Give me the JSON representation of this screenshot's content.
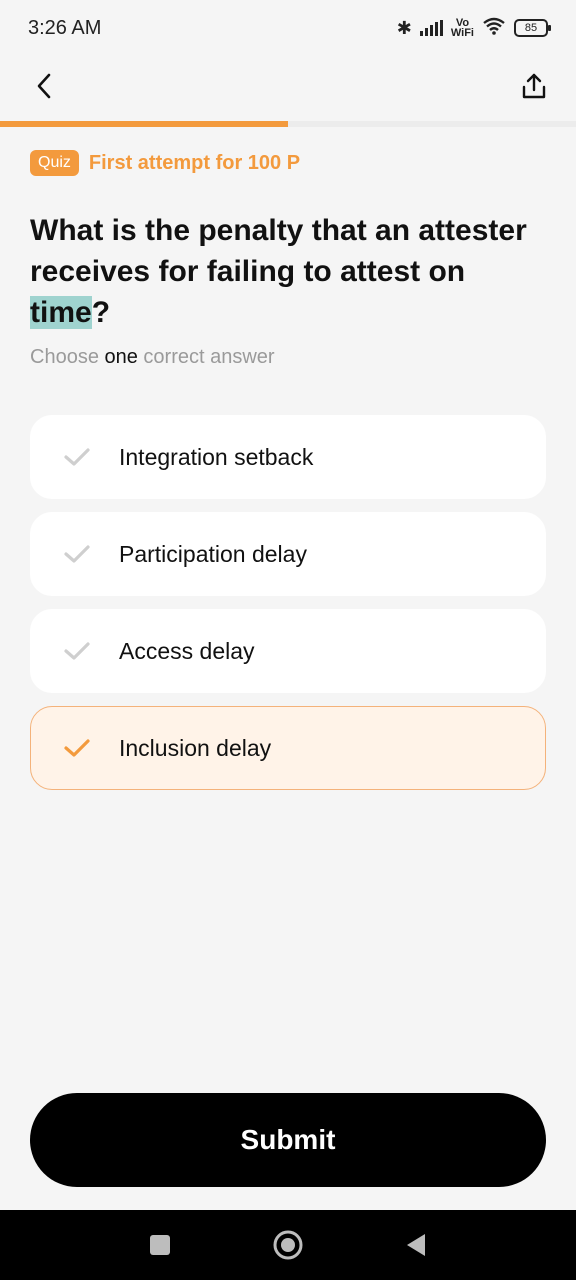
{
  "status_bar": {
    "time": "3:26 AM",
    "vowifi_top": "Vo",
    "vowifi_bottom": "WiFi",
    "battery": "85",
    "icons": [
      "bluetooth-icon",
      "signal-icon",
      "vowifi-icon",
      "wifi-icon",
      "battery-icon"
    ]
  },
  "header": {
    "back_icon": "chevron-left-icon",
    "share_icon": "share-upload-icon"
  },
  "progress": {
    "fraction": 0.5,
    "color": "#f39a3d"
  },
  "quiz": {
    "badge": "Quiz",
    "attempt_text": "First attempt for 100 P"
  },
  "question": {
    "text_before": "What is the penalty that an attester receives for failing to attest on ",
    "highlighted": "time",
    "text_after": "?"
  },
  "instruction": {
    "prefix": "Choose ",
    "emphasis": "one",
    "suffix": " correct answer"
  },
  "options": [
    {
      "label": "Integration setback",
      "selected": false
    },
    {
      "label": "Participation delay",
      "selected": false
    },
    {
      "label": "Access delay",
      "selected": false
    },
    {
      "label": "Inclusion delay",
      "selected": true
    }
  ],
  "submit_label": "Submit",
  "colors": {
    "accent": "#f39a3d",
    "highlight": "#9fd3cf",
    "selected_bg": "#fff3e8",
    "check_inactive": "#cfcfcf"
  }
}
